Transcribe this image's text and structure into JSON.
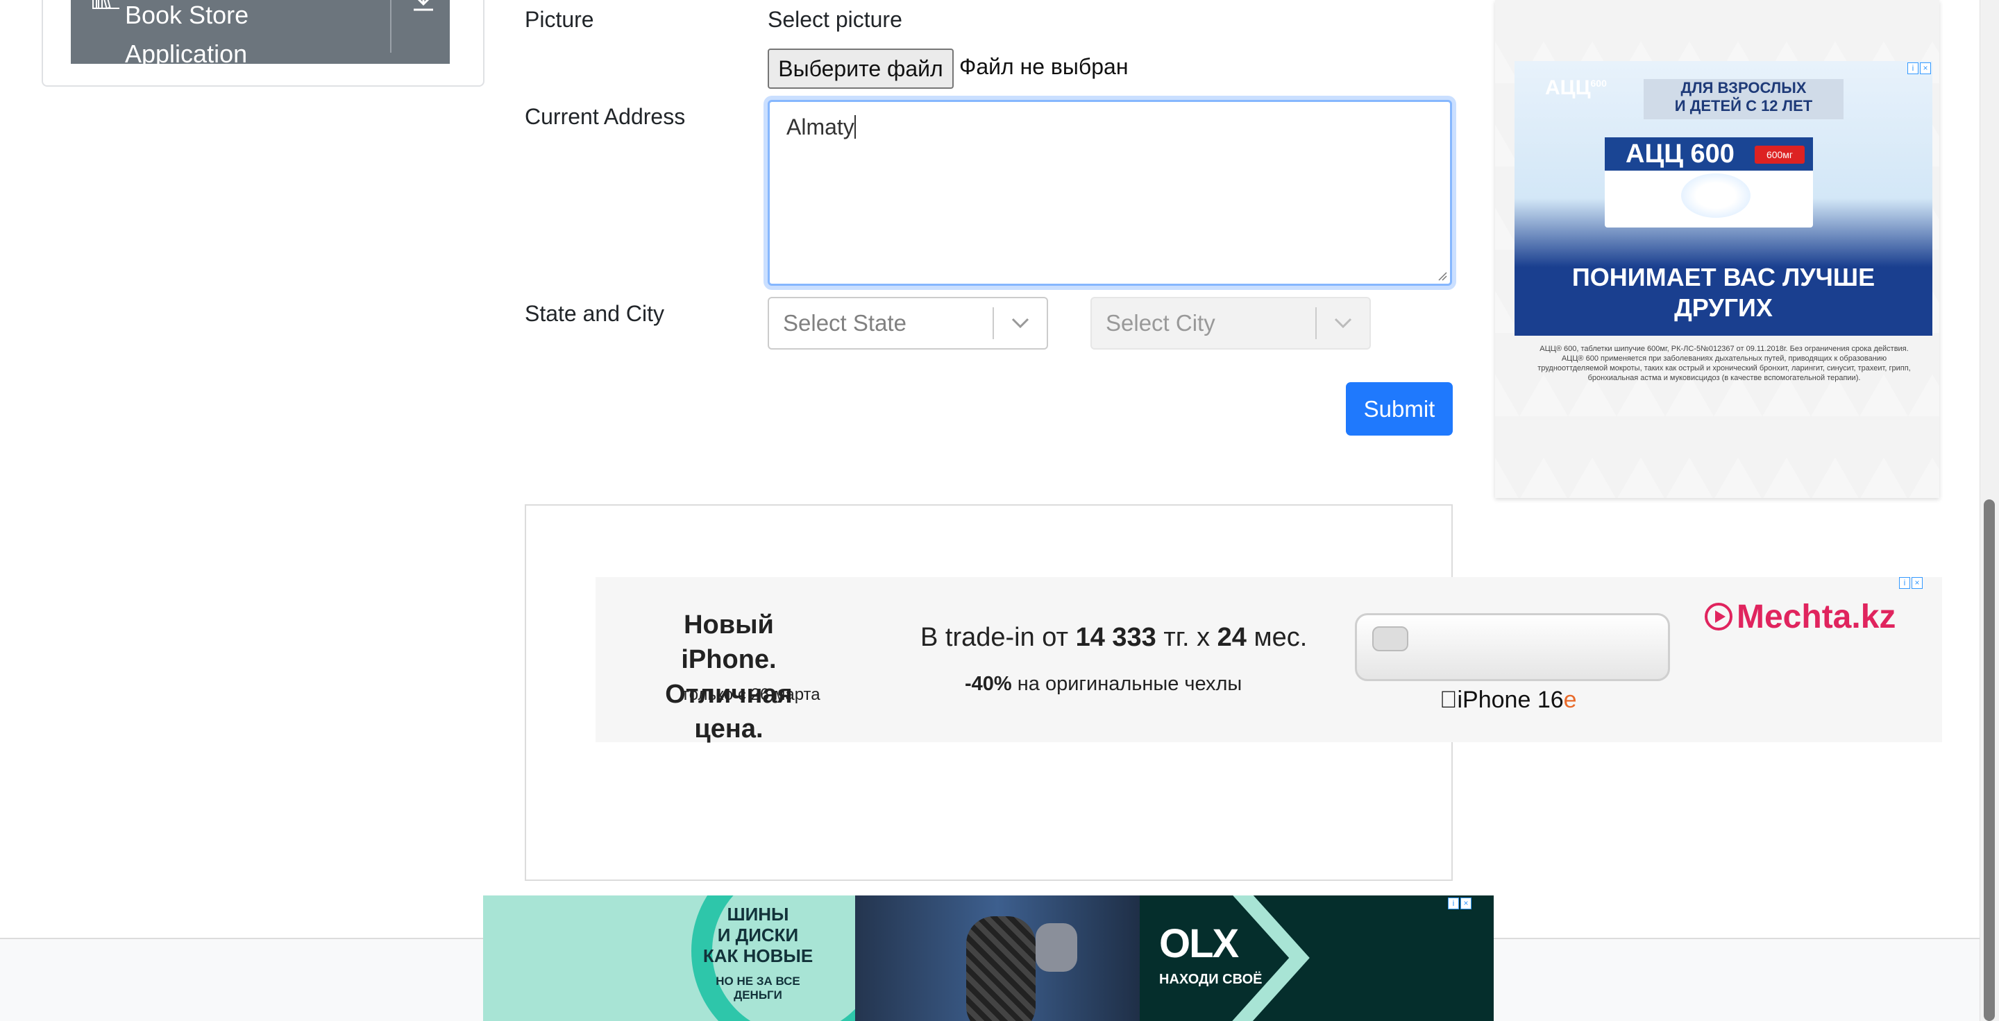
{
  "sidebar": {
    "item_label_line1": "Book Store",
    "item_label_line2": "Application",
    "icon": "books-icon",
    "action_icon": "download-icon"
  },
  "form": {
    "picture_label": "Picture",
    "picture_caption": "Select picture",
    "file_button": "Выберите файл",
    "file_status": "Файл не выбран",
    "address_label": "Current Address",
    "address_value": "Almaty",
    "state_city_label": "State and City",
    "state_placeholder": "Select State",
    "city_placeholder": "Select City",
    "submit": "Submit"
  },
  "ad_right": {
    "brand": "АЦЦ",
    "brand_sup": "600",
    "age_line1": "ДЛЯ ВЗРОСЛЫХ",
    "age_line2": "И ДЕТЕЙ С 12 ЛЕТ",
    "pack_brand": "АЦЦ 600",
    "pack_badge": "600мг",
    "slogan_line1": "ПОНИМАЕТ ВАС ЛУЧШЕ",
    "slogan_line2": "ДРУГИХ",
    "fine_print": "АЦЦ® 600, таблетки шипучие 600мг, РК-ЛС-5№012367 от 09.11.2018г. Без ограничения срока действия. АЦЦ® 600 применяется при заболеваниях дыхательных путей, приводящих к образованию труднооттделяемой мокроты, таких как острый и хронический бронхит, ларингит, синусит, трахеит, грипп, бронхиальная астма и муковисцидоз (в качестве вспомогательной терапии)."
  },
  "ad_middle": {
    "headline_line1": "Новый iPhone.",
    "headline_line2": "Отличная цена.",
    "date_note": "только с 26 марта",
    "tradein_prefix": "В trade-in от ",
    "tradein_price": "14 333",
    "tradein_mid": " тг. х ",
    "tradein_months": "24",
    "tradein_suffix": " мес.",
    "discount": "-40%",
    "discount_text": " на оригинальные чехлы",
    "product": "iPhone 16",
    "product_suffix": "e",
    "store": "Mechta.kz"
  },
  "ad_bottom": {
    "tire_line1": "ШИНЫ",
    "tire_line2": "И ДИСКИ",
    "tire_line3": "КАК НОВЫЕ",
    "tire_sub1": "НО НЕ ЗА ВСЕ",
    "tire_sub2": "ДЕНЬГИ",
    "olx_logo": "OLX",
    "olx_slogan": "НАХОДИ СВОЁ"
  },
  "colors": {
    "primary": "#0d6efd",
    "sidebar_active": "#6c757d",
    "focus_border": "#86b7fe",
    "ad_blue": "#1a3f8f",
    "mechta_red": "#e0245e",
    "olx_bg": "#052e2c"
  }
}
